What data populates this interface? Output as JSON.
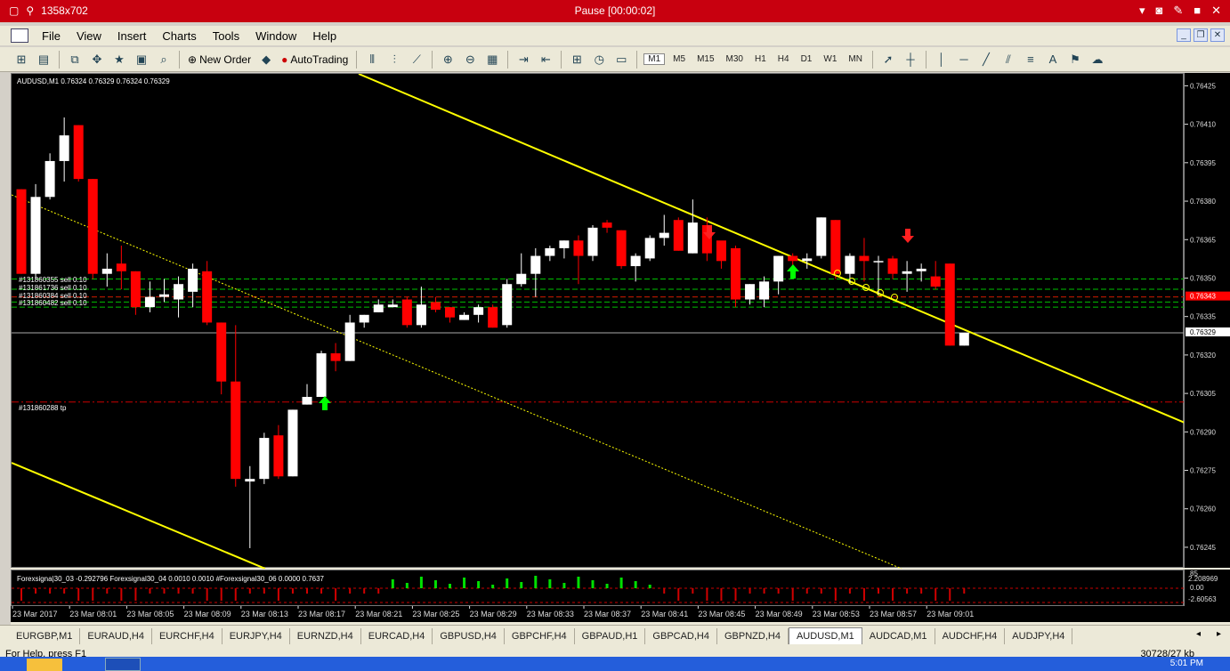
{
  "window": {
    "title": "Pause [00:00:02]",
    "resolution_label": "1358x702"
  },
  "menu": {
    "items": [
      "File",
      "View",
      "Insert",
      "Charts",
      "Tools",
      "Window",
      "Help"
    ]
  },
  "toolbar": {
    "new_order": "New Order",
    "autotrading": "AutoTrading",
    "timeframes": [
      "M1",
      "M5",
      "M15",
      "M30",
      "H1",
      "H4",
      "D1",
      "W1",
      "MN"
    ],
    "active_timeframe": "M1"
  },
  "chart": {
    "header": "AUDUSD,M1  0.76324 0.76329 0.76324 0.76329",
    "order_labels": [
      "#131860355 sell 0.10",
      "#131861736 sell 0.10",
      "#131860384 sell 0.10",
      "#131860482 sell 0.10"
    ],
    "tp_label": "#131860288 tp",
    "current_price_red": "0.76343",
    "current_price_white": "0.76329",
    "indicator_label": "Forexsigna|30_03 -0.292796  Forexsignal30_04 0.0010 0.0010  #Forexsignal30_06 0.0000 0.7637",
    "indicator_axis": [
      "85",
      "2.208969",
      "0.00",
      "-2.60563"
    ]
  },
  "tabs": [
    "EURGBP,M1",
    "EURAUD,H4",
    "EURCHF,H4",
    "EURJPY,H4",
    "EURNZD,H4",
    "EURCAD,H4",
    "GBPUSD,H4",
    "GBPCHF,H4",
    "GBPAUD,H1",
    "GBPCAD,H4",
    "GBPNZD,H4",
    "AUDUSD,M1",
    "AUDCAD,M1",
    "AUDCHF,H4",
    "AUDJPY,H4"
  ],
  "active_tab": "AUDUSD,M1",
  "status": {
    "help": "For Help, press F1",
    "memory": "30728/27 kb",
    "clock": "5:01 PM"
  },
  "chart_data": {
    "type": "candlestick",
    "symbol": "AUDUSD",
    "timeframe": "M1",
    "ylim": [
      0.76237,
      0.7643
    ],
    "yticks": [
      0.76425,
      0.7641,
      0.76395,
      0.7638,
      0.76365,
      0.7635,
      0.76335,
      0.7632,
      0.76305,
      0.7629,
      0.76275,
      0.7626,
      0.76245
    ],
    "time_labels": [
      "23 Mar 2017",
      "23 Mar 08:01",
      "23 Mar 08:05",
      "23 Mar 08:09",
      "23 Mar 08:13",
      "23 Mar 08:17",
      "23 Mar 08:21",
      "23 Mar 08:25",
      "23 Mar 08:29",
      "23 Mar 08:33",
      "23 Mar 08:37",
      "23 Mar 08:41",
      "23 Mar 08:45",
      "23 Mar 08:49",
      "23 Mar 08:53",
      "23 Mar 08:57",
      "23 Mar 09:01"
    ],
    "candles": [
      [
        0.76385,
        0.76352,
        0.76385,
        0.76352
      ],
      [
        0.76352,
        0.76382,
        0.76387,
        0.7635
      ],
      [
        0.76382,
        0.76396,
        0.76399,
        0.76381
      ],
      [
        0.76396,
        0.76406,
        0.76413,
        0.76388
      ],
      [
        0.7641,
        0.76389,
        0.7641,
        0.76388
      ],
      [
        0.76389,
        0.76352,
        0.76389,
        0.7635
      ],
      [
        0.76352,
        0.76354,
        0.7636,
        0.76347
      ],
      [
        0.76356,
        0.76353,
        0.76363,
        0.76346
      ],
      [
        0.76353,
        0.76339,
        0.76353,
        0.76336
      ],
      [
        0.76339,
        0.76343,
        0.76349,
        0.76337
      ],
      [
        0.76343,
        0.76344,
        0.7635,
        0.76341
      ],
      [
        0.76342,
        0.76348,
        0.76351,
        0.76335
      ],
      [
        0.76345,
        0.76354,
        0.76356,
        0.76339
      ],
      [
        0.76353,
        0.76333,
        0.76357,
        0.76332
      ],
      [
        0.76333,
        0.7631,
        0.76333,
        0.76305
      ],
      [
        0.7631,
        0.76272,
        0.76332,
        0.76269
      ],
      [
        0.76271,
        0.76272,
        0.76277,
        0.76245
      ],
      [
        0.76272,
        0.76288,
        0.7629,
        0.7627
      ],
      [
        0.76289,
        0.76273,
        0.76293,
        0.76272
      ],
      [
        0.76273,
        0.76299,
        0.76299,
        0.76273
      ],
      [
        0.76301,
        0.76304,
        0.76309,
        0.76301
      ],
      [
        0.76304,
        0.76321,
        0.76322,
        0.76304
      ],
      [
        0.76321,
        0.76318,
        0.76325,
        0.76314
      ],
      [
        0.76318,
        0.76333,
        0.76336,
        0.76318
      ],
      [
        0.76333,
        0.76336,
        0.76336,
        0.76331
      ],
      [
        0.76337,
        0.7634,
        0.76342,
        0.76337
      ],
      [
        0.76339,
        0.7634,
        0.76342,
        0.76339
      ],
      [
        0.76342,
        0.76332,
        0.76343,
        0.76331
      ],
      [
        0.76332,
        0.7634,
        0.76347,
        0.76331
      ],
      [
        0.76341,
        0.76338,
        0.76343,
        0.76337
      ],
      [
        0.76339,
        0.76335,
        0.76339,
        0.76333
      ],
      [
        0.76334,
        0.76336,
        0.76337,
        0.76334
      ],
      [
        0.76336,
        0.76339,
        0.7634,
        0.76333
      ],
      [
        0.76339,
        0.76331,
        0.7634,
        0.76331
      ],
      [
        0.76332,
        0.76348,
        0.7635,
        0.76331
      ],
      [
        0.76348,
        0.76352,
        0.7636,
        0.76347
      ],
      [
        0.76352,
        0.76359,
        0.76362,
        0.76343
      ],
      [
        0.76359,
        0.76362,
        0.76363,
        0.76357
      ],
      [
        0.76362,
        0.76365,
        0.76365,
        0.76358
      ],
      [
        0.76365,
        0.76359,
        0.76367,
        0.76348
      ],
      [
        0.76359,
        0.7637,
        0.76371,
        0.76357
      ],
      [
        0.76372,
        0.7637,
        0.76373,
        0.76368
      ],
      [
        0.76369,
        0.76355,
        0.76369,
        0.76354
      ],
      [
        0.76355,
        0.76359,
        0.7636,
        0.76349
      ],
      [
        0.76358,
        0.76366,
        0.76367,
        0.76357
      ],
      [
        0.76366,
        0.76368,
        0.76375,
        0.76363
      ],
      [
        0.76373,
        0.76361,
        0.76374,
        0.76361
      ],
      [
        0.7636,
        0.76372,
        0.76381,
        0.7636
      ],
      [
        0.76371,
        0.7636,
        0.76374,
        0.76357
      ],
      [
        0.76365,
        0.76357,
        0.76364,
        0.76354
      ],
      [
        0.76362,
        0.76342,
        0.76363,
        0.76339
      ],
      [
        0.76342,
        0.76348,
        0.76348,
        0.7634
      ],
      [
        0.76342,
        0.76349,
        0.76351,
        0.76339
      ],
      [
        0.76349,
        0.76359,
        0.76359,
        0.76344
      ],
      [
        0.76359,
        0.76357,
        0.7636,
        0.76355
      ],
      [
        0.76357,
        0.76358,
        0.7636,
        0.76354
      ],
      [
        0.76359,
        0.76374,
        0.76374,
        0.76358
      ],
      [
        0.76373,
        0.76352,
        0.76373,
        0.7635
      ],
      [
        0.76352,
        0.76359,
        0.7636,
        0.76348
      ],
      [
        0.76359,
        0.76357,
        0.76366,
        0.76349
      ],
      [
        0.76357,
        0.76357,
        0.76359,
        0.76344
      ],
      [
        0.76358,
        0.76352,
        0.76359,
        0.7635
      ],
      [
        0.76352,
        0.76353,
        0.76357,
        0.76345
      ],
      [
        0.76353,
        0.76354,
        0.76356,
        0.76349
      ],
      [
        0.76351,
        0.76347,
        0.76357,
        0.76346
      ],
      [
        0.76356,
        0.76324,
        0.76356,
        0.76324
      ],
      [
        0.76324,
        0.76329,
        0.76329,
        0.76324
      ]
    ]
  }
}
